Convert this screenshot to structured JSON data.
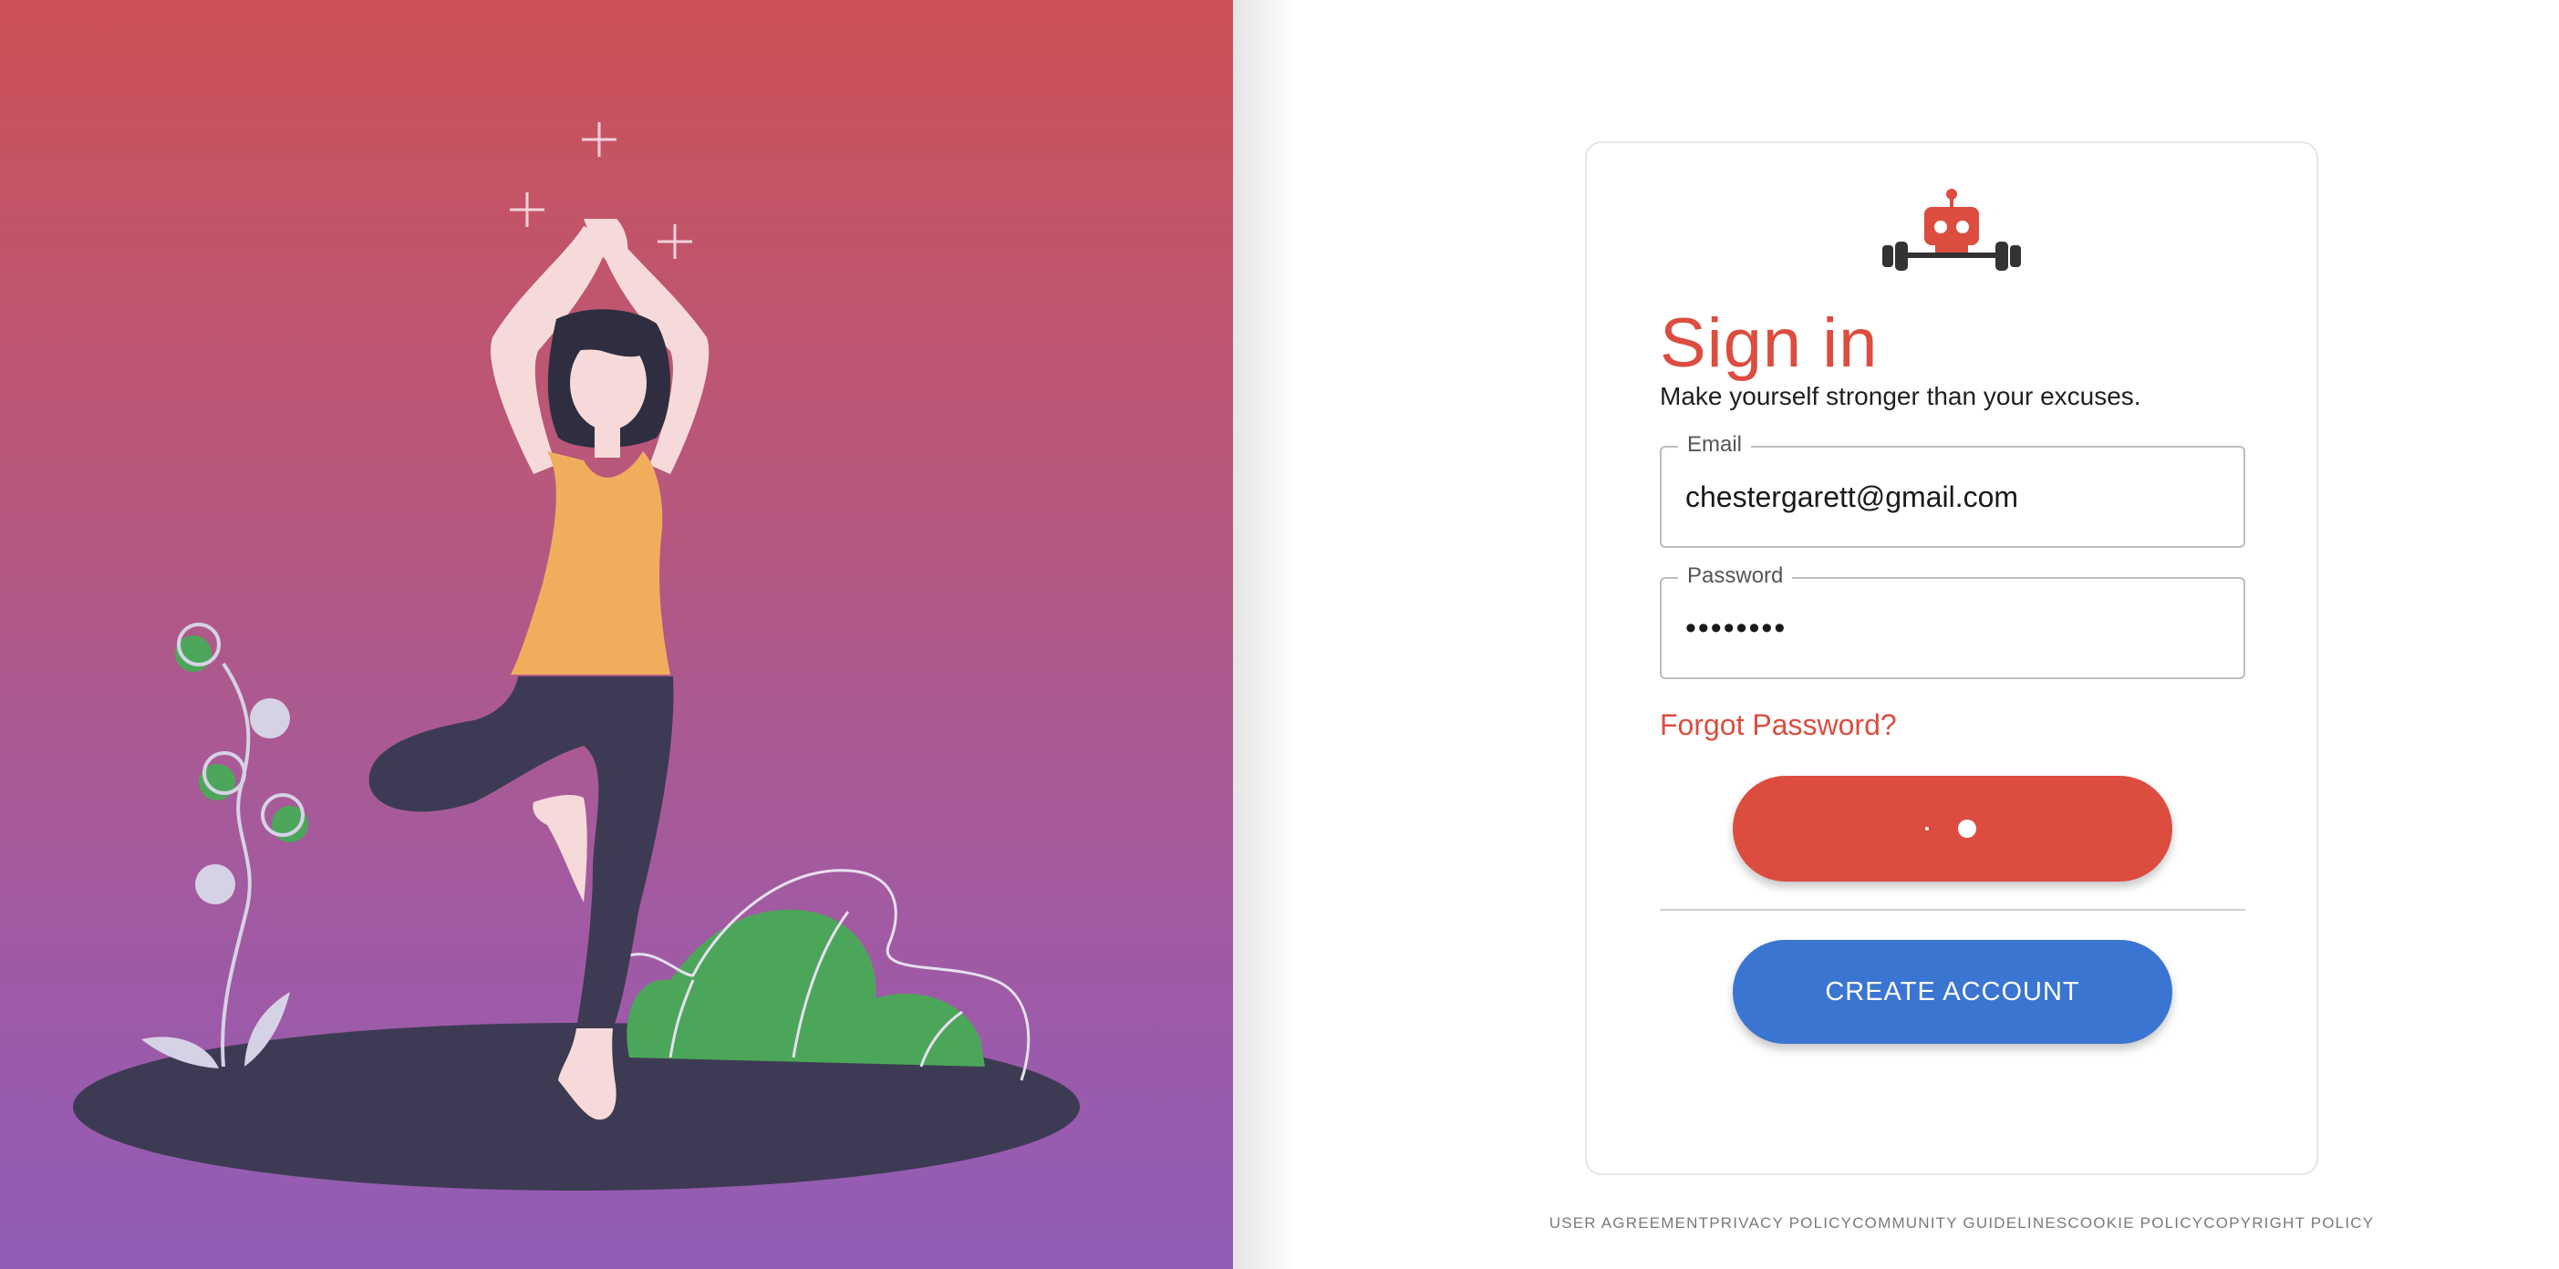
{
  "signin": {
    "title": "Sign in",
    "subtitle": "Make yourself stronger than your excuses.",
    "email_label": "Email",
    "email_value": "chestergarett@gmail.com",
    "password_label": "Password",
    "password_value": "••••••••",
    "forgot_label": "Forgot Password?",
    "create_label": "CREATE ACCOUNT"
  },
  "footer": {
    "links": [
      "USER AGREEMENT",
      "PRIVACY POLICY",
      "COMMUNITY GUIDELINES",
      "COOKIE POLICY",
      "COPYRIGHT POLICY"
    ]
  },
  "colors": {
    "accent": "#dc4d40",
    "secondary": "#3a75d1",
    "hero_top": "#cd5157",
    "hero_bottom": "#915cb7"
  },
  "icons": {
    "logo": "robot-barbell-logo",
    "hero": "yoga-woman-illustration"
  }
}
